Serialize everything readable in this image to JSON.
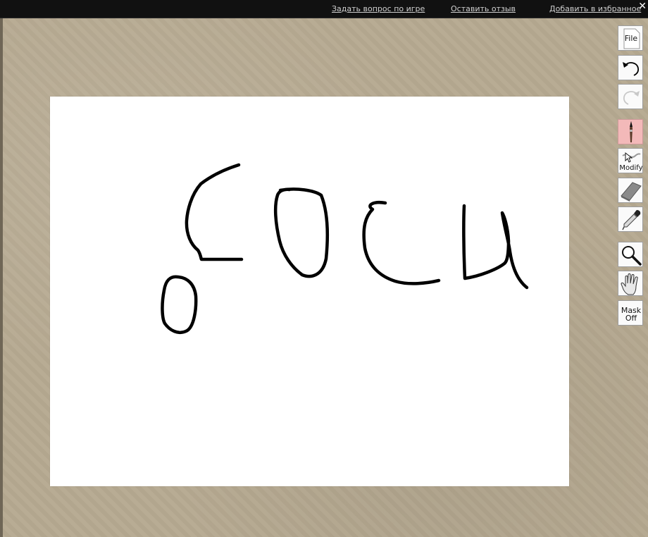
{
  "topbar": {
    "links": [
      {
        "label": "Задать вопрос по игре"
      },
      {
        "label": "Оставить отзыв"
      },
      {
        "label": "Добавить в избранное"
      }
    ],
    "close_label": "✕"
  },
  "toolbar": {
    "file_label": "File",
    "modify_label": "Modify",
    "mask_label_line1": "Mask",
    "mask_label_line2": "Off",
    "tools": [
      {
        "name": "file",
        "icon": "file-icon"
      },
      {
        "name": "undo",
        "icon": "undo-icon"
      },
      {
        "name": "redo",
        "icon": "redo-icon",
        "enabled": false
      },
      {
        "name": "brush",
        "icon": "brush-icon",
        "active": true
      },
      {
        "name": "modify",
        "icon": "modify-icon"
      },
      {
        "name": "eraser",
        "icon": "eraser-icon"
      },
      {
        "name": "eyedropper",
        "icon": "eyedropper-icon"
      },
      {
        "name": "zoom",
        "icon": "magnifier-icon"
      },
      {
        "name": "pan",
        "icon": "hand-icon"
      },
      {
        "name": "mask",
        "icon": "mask-icon"
      }
    ]
  },
  "colors": {
    "topbar": "#111111",
    "workspace": "#b6a991",
    "canvas": "#ffffff",
    "active_tool": "#f3b9b9",
    "stroke": "#000000"
  }
}
